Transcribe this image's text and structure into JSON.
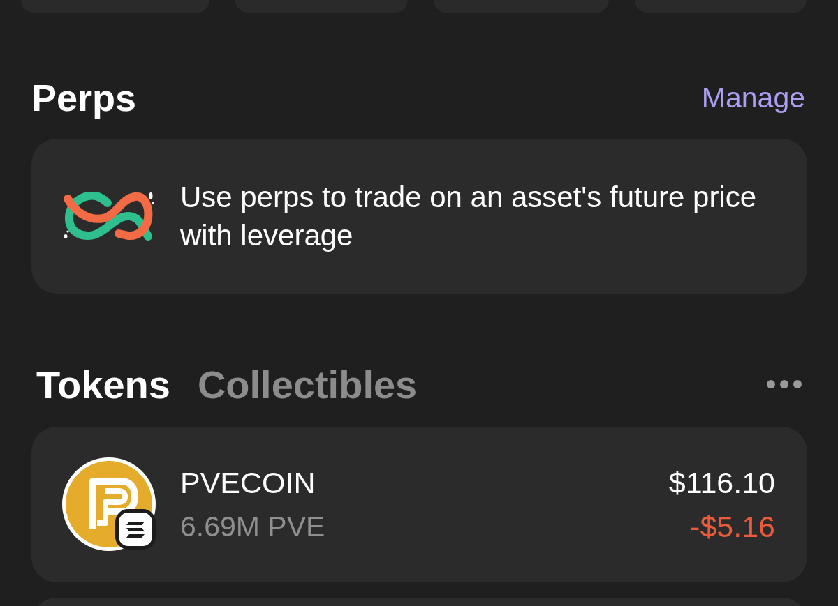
{
  "perps": {
    "title": "Perps",
    "action": "Manage",
    "promo": "Use perps to trade on an asset's future price with leverage"
  },
  "asset_tabs": [
    {
      "label": "Tokens",
      "selected": true
    },
    {
      "label": "Collectibles",
      "selected": false
    }
  ],
  "tokens": [
    {
      "name": "PVECOIN",
      "balance": "6.69M PVE",
      "value": "$116.10",
      "change": "-$5.16",
      "loss": true
    }
  ]
}
